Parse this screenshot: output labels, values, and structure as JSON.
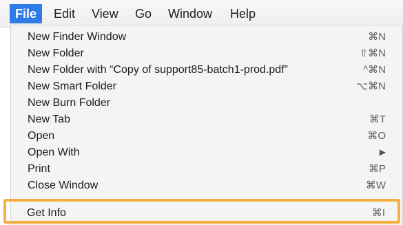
{
  "menubar": {
    "items": [
      {
        "label": "File"
      },
      {
        "label": "Edit"
      },
      {
        "label": "View"
      },
      {
        "label": "Go"
      },
      {
        "label": "Window"
      },
      {
        "label": "Help"
      }
    ]
  },
  "menu": {
    "items": [
      {
        "label": "New Finder Window",
        "shortcut": "⌘N"
      },
      {
        "label": "New Folder",
        "shortcut": "⇧⌘N"
      },
      {
        "label": "New Folder with “Copy of support85-batch1-prod.pdf”",
        "shortcut": "^⌘N"
      },
      {
        "label": "New Smart Folder",
        "shortcut": "⌥⌘N"
      },
      {
        "label": "New Burn Folder",
        "shortcut": ""
      },
      {
        "label": "New Tab",
        "shortcut": "⌘T"
      },
      {
        "label": "Open",
        "shortcut": "⌘O"
      },
      {
        "label": "Open With",
        "shortcut": "▶"
      },
      {
        "label": "Print",
        "shortcut": "⌘P"
      },
      {
        "label": "Close Window",
        "shortcut": "⌘W"
      }
    ],
    "highlighted_item": {
      "label": "Get Info",
      "shortcut": "⌘I"
    }
  },
  "colors": {
    "menu_active": "#2f7be8",
    "highlight_border": "#f5b041"
  }
}
